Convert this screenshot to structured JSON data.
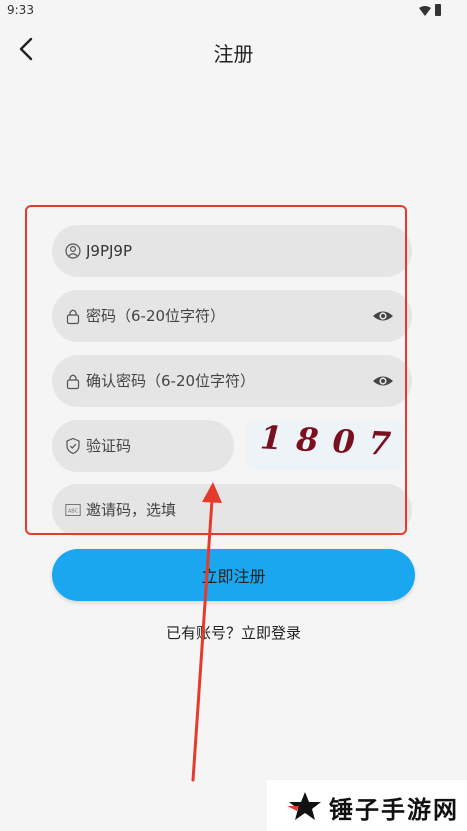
{
  "status_bar": {
    "time": "9:33",
    "icons": [
      "wifi-icon",
      "battery-icon"
    ]
  },
  "header": {
    "back_icon": "chevron-left-icon",
    "title": "注册"
  },
  "form": {
    "username": {
      "value": "J9PJ9P",
      "icon": "user-icon"
    },
    "password": {
      "placeholder": "密码（6-20位字符）",
      "icon": "lock-icon",
      "toggle_icon": "eye-icon"
    },
    "confirm_password": {
      "placeholder": "确认密码（6-20位字符）",
      "icon": "lock-icon",
      "toggle_icon": "eye-icon"
    },
    "captcha_input": {
      "placeholder": "验证码",
      "icon": "shield-icon"
    },
    "captcha_image": {
      "text": "1807"
    },
    "invite_code": {
      "placeholder": "邀请码，选填",
      "icon": "abc-icon"
    },
    "register_label": "立即注册",
    "login_prompt": "已有账号？立即登录"
  },
  "annotation": {
    "highlight_color": "#e53b2c"
  },
  "watermark": {
    "text": "锤子手游网"
  },
  "colors": {
    "primary": "#1aa7f0",
    "field_bg": "#e5e5e5",
    "background": "#f5f5f5"
  }
}
